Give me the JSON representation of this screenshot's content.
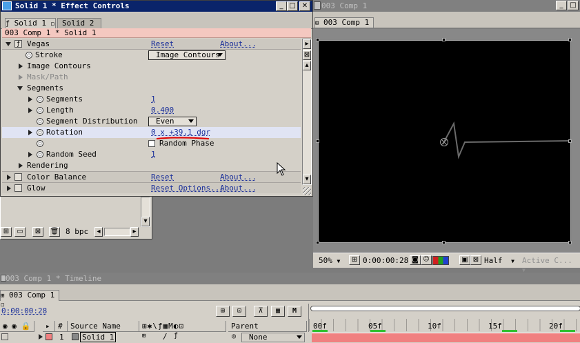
{
  "effect_controls": {
    "window_title": "Solid 1 * Effect Controls",
    "tabs": [
      "Solid 1",
      "Solid 2"
    ],
    "breadcrumb": "003 Comp 1 * Solid 1",
    "rows": {
      "vegas": {
        "label": "Vegas",
        "reset": "Reset",
        "about": "About..."
      },
      "stroke": {
        "label": "Stroke",
        "value": "Image Contours"
      },
      "image_contours": {
        "label": "Image Contours"
      },
      "mask_path": {
        "label": "Mask/Path"
      },
      "segments_group": {
        "label": "Segments"
      },
      "segments": {
        "label": "Segments",
        "value": "1"
      },
      "length": {
        "label": "Length",
        "value": "0.400"
      },
      "segment_distribution": {
        "label": "Segment Distribution",
        "value": "Even"
      },
      "rotation": {
        "label": "Rotation",
        "value": "0 x +39.1 dgr"
      },
      "random_phase": {
        "label": "Random Phase"
      },
      "random_seed": {
        "label": "Random Seed",
        "value": "1"
      },
      "rendering": {
        "label": "Rendering"
      },
      "color_balance": {
        "label": "Color Balance",
        "reset": "Reset",
        "about": "About..."
      },
      "glow": {
        "label": "Glow",
        "reset": "Reset Options...",
        "about": "About..."
      }
    }
  },
  "project_bar": {
    "bpc": "8 bpc"
  },
  "comp_window": {
    "title": "003 Comp 1",
    "tab": "003 Comp 1",
    "zoom": "50%",
    "timecode": "0:00:00:28",
    "resolution": "Half",
    "camera": "Active C..."
  },
  "timeline": {
    "title": "003 Comp 1 * Timeline",
    "tab": "003 Comp 1",
    "timecode": "0:00:00:28",
    "columns": {
      "hash": "#",
      "source_name": "Source Name",
      "parent": "Parent"
    },
    "ruler": [
      "00f",
      "05f",
      "10f",
      "15f",
      "20f"
    ],
    "layer": {
      "number": "1",
      "name": "Solid 1",
      "parent": "None"
    }
  },
  "colors": {
    "titlebar": "#0a246a",
    "breadcrumb_bg": "#f4c8c0",
    "selected_row": "#e0e4f4",
    "annotation": "#e00000",
    "work_area": "#f08080"
  }
}
